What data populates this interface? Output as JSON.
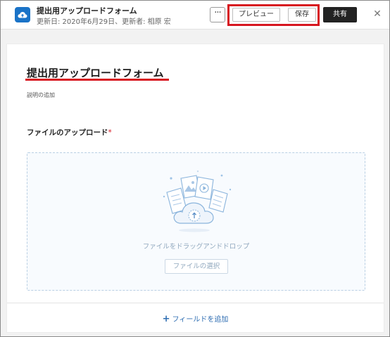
{
  "header": {
    "title": "提出用アップロードフォーム",
    "subtitle": "更新日: 2020年6月29日、更新者: 相原 宏",
    "more_label": "···",
    "preview_label": "プレビュー",
    "save_label": "保存",
    "share_label": "共有",
    "close_label": "✕",
    "app_icon": "cloud-upload-icon",
    "highlight_color": "#d7151f"
  },
  "form": {
    "title": "提出用アップロードフォーム",
    "description_placeholder": "説明の追加",
    "field": {
      "label": "ファイルのアップロード",
      "required_mark": "*",
      "dropzone_text": "ファイルをドラッグアンドドロップ",
      "select_button_label": "ファイルの選択"
    },
    "add_field_label": "フィールドを追加",
    "add_field_icon": "plus-icon"
  },
  "colors": {
    "accent": "#1a73c7",
    "link": "#2e6db2",
    "dark_button": "#222222"
  }
}
